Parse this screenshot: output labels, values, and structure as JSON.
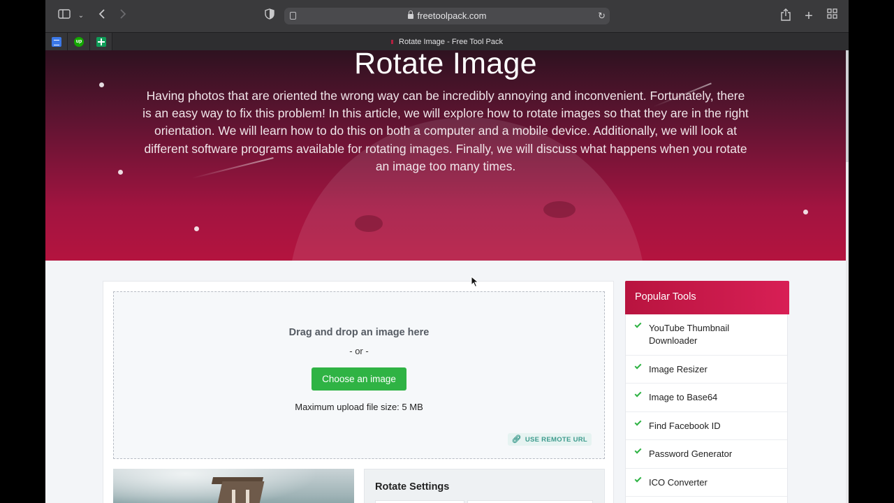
{
  "browser": {
    "url": "freetoolpack.com",
    "tab_title": "Rotate Image - Free Tool Pack",
    "pinned_tabs": [
      {
        "icon": "google-docs-icon"
      },
      {
        "icon": "upwork-icon",
        "text": "up"
      },
      {
        "icon": "google-sheets-icon"
      }
    ]
  },
  "hero": {
    "title": "Rotate Image",
    "description": "Having photos that are oriented the wrong way can be incredibly annoying and inconvenient. Fortunately, there is an easy way to fix this problem! In this article, we will explore how to rotate images so that they are in the right orientation. We will learn how to do this on both a computer and a mobile device. Additionally, we will look at different software programs available for rotating images. Finally, we will discuss what happens when you rotate an image too many times."
  },
  "upload": {
    "drag_text": "Drag and drop an image here",
    "or_text": "- or -",
    "choose_label": "Choose an image",
    "max_size": "Maximum upload file size: 5 MB",
    "remote_url_label": "USE REMOTE URL"
  },
  "settings": {
    "title": "Rotate Settings"
  },
  "sidebar": {
    "title": "Popular Tools",
    "items": [
      {
        "label": "YouTube Thumbnail Downloader"
      },
      {
        "label": "Image Resizer"
      },
      {
        "label": "Image to Base64"
      },
      {
        "label": "Find Facebook ID"
      },
      {
        "label": "Password Generator"
      },
      {
        "label": "ICO Converter"
      }
    ]
  },
  "colors": {
    "accent_green": "#2fb344",
    "hero_red": "#b4143f",
    "sidebar_header": "#d81f55"
  }
}
